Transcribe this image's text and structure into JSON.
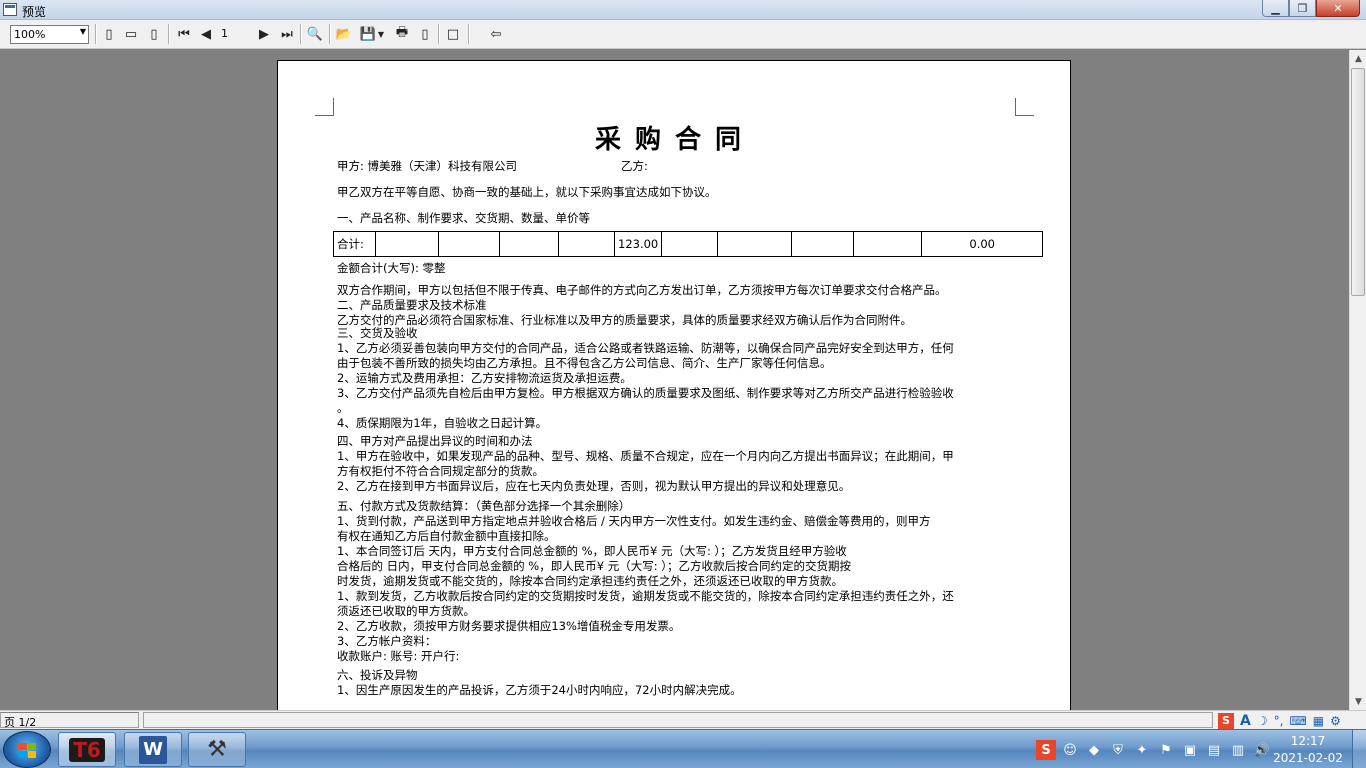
{
  "window": {
    "title": "预览"
  },
  "toolbar": {
    "zoom": "100%",
    "page_input": "1"
  },
  "document": {
    "title": "采购合同",
    "party_a": "甲方: 博美雅（天津）科技有限公司",
    "party_b": "乙方:",
    "intro": "甲乙双方在平等自愿、协商一致的基础上，就以下采购事宜达成如下协议。",
    "section1": "一、产品名称、制作要求、交货期、数量、单价等",
    "table": {
      "total_label": "合计:",
      "quantity_total": "123.00",
      "amount_total": "0.00"
    },
    "amount_words": "金额合计(大写): 零整",
    "lines": [
      "双方合作期间，甲方以包括但不限于传真、电子邮件的方式向乙方发出订单，乙方须按甲方每次订单要求交付合格产品。",
      "二、产品质量要求及技术标准",
      "乙方交付的产品必须符合国家标准、行业标准以及甲方的质量要求，具体的质量要求经双方确认后作为合同附件。",
      "三、交货及验收",
      "1、乙方必须妥善包装向甲方交付的合同产品，适合公路或者铁路运输、防潮等，以确保合同产品完好安全到达甲方，任何",
      "由于包装不善所致的损失均由乙方承担。且不得包含乙方公司信息、简介、生产厂家等任何信息。",
      "2、运输方式及费用承担：乙方安排物流运货及承担运费。",
      "3、乙方交付产品须先自检后由甲方复检。甲方根据双方确认的质量要求及图纸、制作要求等对乙方所交产品进行检验验收",
      "。",
      "4、质保期限为1年，自验收之日起计算。",
      "四、甲方对产品提出异议的时间和办法",
      "1、甲方在验收中，如果发现产品的品种、型号、规格、质量不合规定，应在一个月内向乙方提出书面异议；在此期间，甲",
      "方有权拒付不符合合同规定部分的货款。",
      "2、乙方在接到甲方书面异议后，应在七天内负责处理，否则，视为默认甲方提出的异议和处理意见。",
      "五、付款方式及货款结算：（黄色部分选择一个其余删除）",
      "1、货到付款，产品送到甲方指定地点并验收合格后  /  天内甲方一次性支付。如发生违约金、赔偿金等费用的，则甲方",
      "有权在通知乙方后自付款金额中直接扣除。",
      "1、本合同签订后      天内，甲方支付合同总金额的      %，即人民币¥      元（大写:         ）；乙方发货且经甲方验收",
      "合格后的      日内，甲支付合同总金额的      %，即人民币¥      元（大写:        ）；乙方收款后按合同约定的交货期按",
      "时发货，逾期发货或不能交货的，除按本合同约定承担违约责任之外，还须返还已收取的甲方货款。",
      "1、款到发货，乙方收款后按合同约定的交货期按时发货，逾期发货或不能交货的，除按本合同约定承担违约责任之外，还",
      "须返还已收取的甲方货款。",
      "2、乙方收款，须按甲方财务要求提供相应13%增值税金专用发票。",
      "3、乙方帐户资料：",
      "收款账户:                  账号:               开户行:",
      "六、投诉及异物",
      "1、因生产原因发生的产品投诉，乙方须于24小时内响应，72小时内解决完成。"
    ]
  },
  "status": {
    "page": "页 1/2"
  },
  "ime": {
    "lang": "A"
  },
  "taskbar": {
    "time": "12:17",
    "date": "2021-02-02",
    "apps": [
      {
        "name": "t6",
        "label": "T6"
      },
      {
        "name": "word",
        "label": "W"
      },
      {
        "name": "tool",
        "label": "⚒"
      }
    ]
  }
}
